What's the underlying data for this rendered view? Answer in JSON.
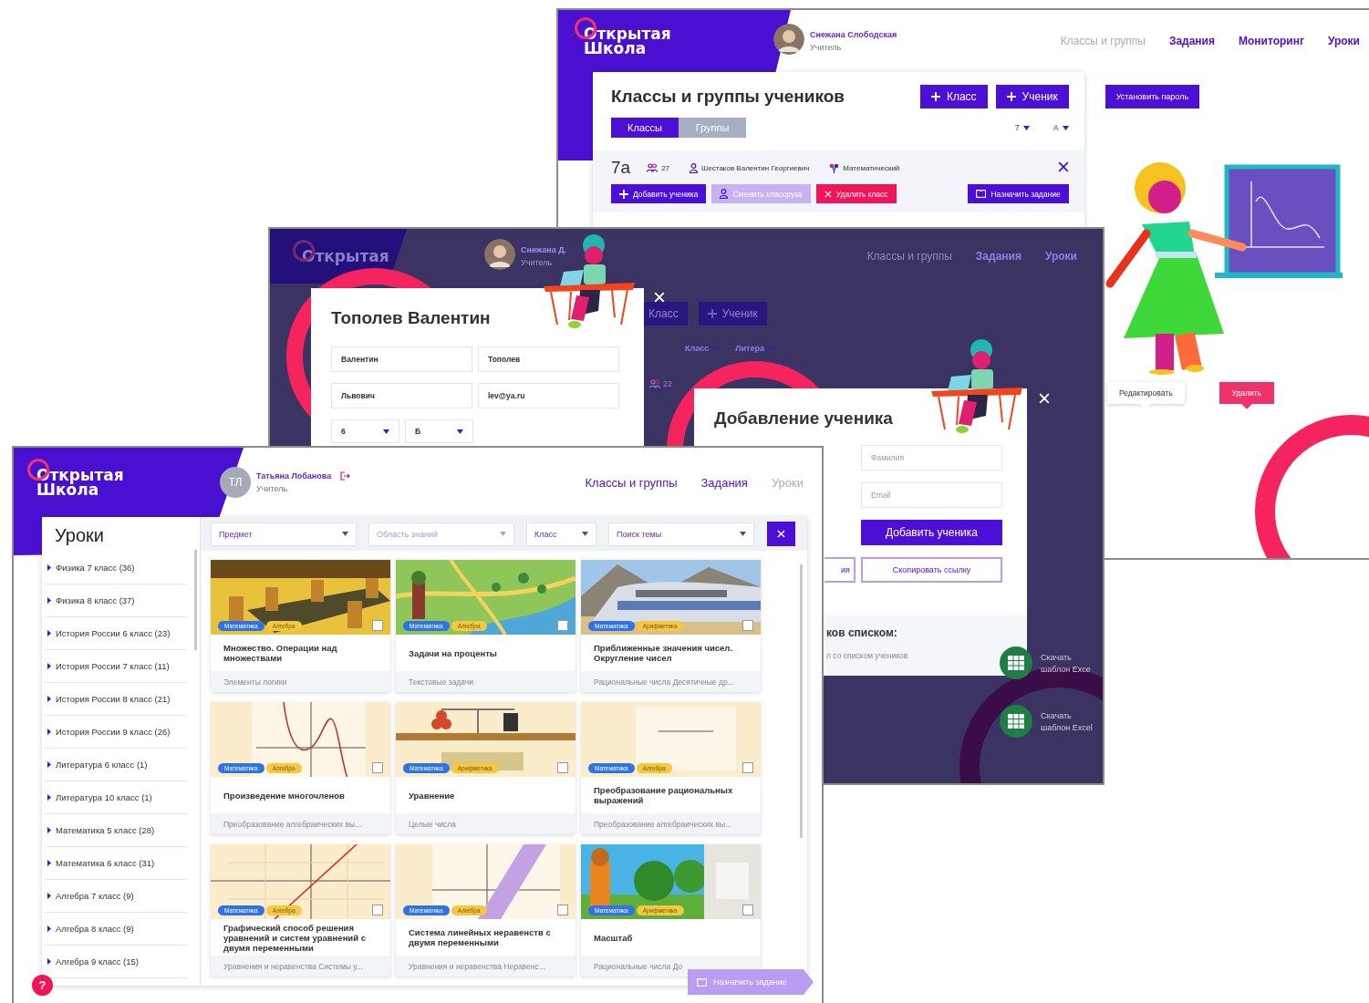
{
  "back_window": {
    "logo": [
      "Открытая",
      "Школа"
    ],
    "user": {
      "name": "Снежана Слободская",
      "role": "Учитель"
    },
    "nav": [
      {
        "label": "Классы и группы",
        "selected": true
      },
      {
        "label": "Задания",
        "selected": false
      },
      {
        "label": "Мониторинг",
        "selected": false
      },
      {
        "label": "Уроки",
        "selected": false
      }
    ],
    "panel": {
      "title": "Классы и группы учеников",
      "add_buttons": [
        "Класс",
        "Ученик"
      ],
      "tabs": [
        {
          "label": "Классы",
          "selected": true
        },
        {
          "label": "Группы",
          "selected": false
        }
      ],
      "filters": [
        "7",
        "А"
      ],
      "class_card": {
        "name": "7а",
        "students": "27",
        "teacher": "Шестаков Валентин Георгиевич",
        "profile": "Математический",
        "actions": [
          {
            "label": "Добавить ученика",
            "kind": "add"
          },
          {
            "label": "Сменить классрука",
            "kind": "disabled"
          },
          {
            "label": "Удалить класс",
            "kind": "delete"
          },
          {
            "label": "Назначить задание",
            "kind": "assign"
          }
        ]
      }
    },
    "password_button": "Установить пароль",
    "tooltips": [
      {
        "label": "Редактировать",
        "kind": "light"
      },
      {
        "label": "Удалить",
        "kind": "danger"
      }
    ]
  },
  "middle_window": {
    "logo": "Открытая",
    "user": {
      "name": "Снежана Д.",
      "role": "Учитель"
    },
    "nav": [
      {
        "label": "Классы и группы",
        "selected": true
      },
      {
        "label": "Задания",
        "selected": false
      },
      {
        "label": "Уроки",
        "selected": false
      }
    ],
    "behind": {
      "buttons": [
        "Класс",
        "Ученик"
      ],
      "filters": [
        "Класс",
        "Литера"
      ],
      "count": "22"
    },
    "student_modal": {
      "title": "Тополев Валентин",
      "fields": [
        "Валентин",
        "Тополев",
        "Львович",
        "lev@ya.ru"
      ],
      "selects": [
        "6",
        "Б"
      ]
    },
    "add_modal": {
      "title": "Добавление ученика",
      "fields": [
        {
          "placeholder": "Фамилия"
        },
        {
          "placeholder": "Email"
        }
      ],
      "add_button": "Добавить ученика",
      "link_button_fragment": "ия",
      "copy_button": "Скопировать ссылку",
      "list_heading": "ков списком:",
      "list_hint": "л со списком учеников"
    },
    "downloads": [
      {
        "line1": "Скачать",
        "line2": "шаблон Exce"
      },
      {
        "line1": "Скачать",
        "line2": "шаблон Excel"
      }
    ]
  },
  "front_window": {
    "logo": [
      "Открытая",
      "Школа"
    ],
    "user": {
      "initials": "ТЛ",
      "name": "Татьяна Лобанова",
      "role": "Учитель"
    },
    "nav": [
      {
        "label": "Классы и группы",
        "selected": false
      },
      {
        "label": "Задания",
        "selected": false
      },
      {
        "label": "Уроки",
        "selected": true
      }
    ],
    "sidebar": {
      "title": "Уроки",
      "items": [
        "Физика 7 класс (36)",
        "Физика 8 класс (37)",
        "История России 6 класс (23)",
        "История России 7 класс (11)",
        "История России 8 класс (21)",
        "История России 9 класс (26)",
        "Литература 6 класс (1)",
        "Литература 10 класс (1)",
        "Математика 5 класс (28)",
        "Математика 6 класс (31)",
        "Алгебра 7 класс (9)",
        "Алгебра 8 класс (9)",
        "Алгебра 9 класс (15)"
      ]
    },
    "filters": [
      {
        "label": "Предмет",
        "disabled": false
      },
      {
        "label": "Область знаний",
        "disabled": true
      },
      {
        "label": "Класс",
        "disabled": false
      },
      {
        "label": "Поиск темы",
        "disabled": false
      }
    ],
    "cards": [
      {
        "title": "Множество. Операции над множествами",
        "subtitle": "Элементы логики",
        "tags": [
          {
            "label": "Математика",
            "color": "#2f74e6"
          },
          {
            "label": "Алгебра",
            "color": "#f5c842"
          }
        ],
        "checked": false
      },
      {
        "title": "Задачи на проценты",
        "subtitle": "Текстовые задачи",
        "tags": [
          {
            "label": "Математика",
            "color": "#2f74e6"
          },
          {
            "label": "Алгебра",
            "color": "#f5c842"
          }
        ],
        "checked": false
      },
      {
        "title": "Приближенные значения чисел. Округление чисел",
        "subtitle": "Рациональные числа Десятичные др...",
        "tags": [
          {
            "label": "Математика",
            "color": "#2f74e6"
          },
          {
            "label": "Арифметика",
            "color": "#f5c842"
          }
        ],
        "checked": false
      },
      {
        "title": "Произведение многочленов",
        "subtitle": "Преобразование алгебраических вы...",
        "tags": [
          {
            "label": "Математика",
            "color": "#2f74e6"
          },
          {
            "label": "Алгебра",
            "color": "#f5c842"
          }
        ],
        "checked": false
      },
      {
        "title": "Уравнение",
        "subtitle": "Целые числа",
        "tags": [
          {
            "label": "Математика",
            "color": "#2f74e6"
          },
          {
            "label": "Арифметика",
            "color": "#f5c842"
          }
        ],
        "checked": false
      },
      {
        "title": "Преобразование рациональных выражений",
        "subtitle": "Преобразование алгебраических вы...",
        "tags": [
          {
            "label": "Математика",
            "color": "#2f74e6"
          },
          {
            "label": "Алгебра",
            "color": "#f5c842"
          }
        ],
        "checked": false
      },
      {
        "title": "Графический способ решения уравнений и систем уравнений с двумя переменными",
        "subtitle": "Уравнения и неравенства Системы у...",
        "tags": [
          {
            "label": "Математика",
            "color": "#2f74e6"
          },
          {
            "label": "Алгебра",
            "color": "#f5c842"
          }
        ],
        "checked": false
      },
      {
        "title": "Система линейных неравенств с двумя переменными",
        "subtitle": "Уравнения и неравенства Неравенс...",
        "tags": [
          {
            "label": "Математика",
            "color": "#2f74e6"
          },
          {
            "label": "Алгебра",
            "color": "#f5c842"
          }
        ],
        "checked": false
      },
      {
        "title": "Масштаб",
        "subtitle": "Рациональные числа До",
        "tags": [
          {
            "label": "Математика",
            "color": "#2f74e6"
          },
          {
            "label": "Арифметика",
            "color": "#f5c842"
          }
        ],
        "checked": false
      }
    ],
    "help_button": "?",
    "assign_button": "Назначить задание"
  }
}
